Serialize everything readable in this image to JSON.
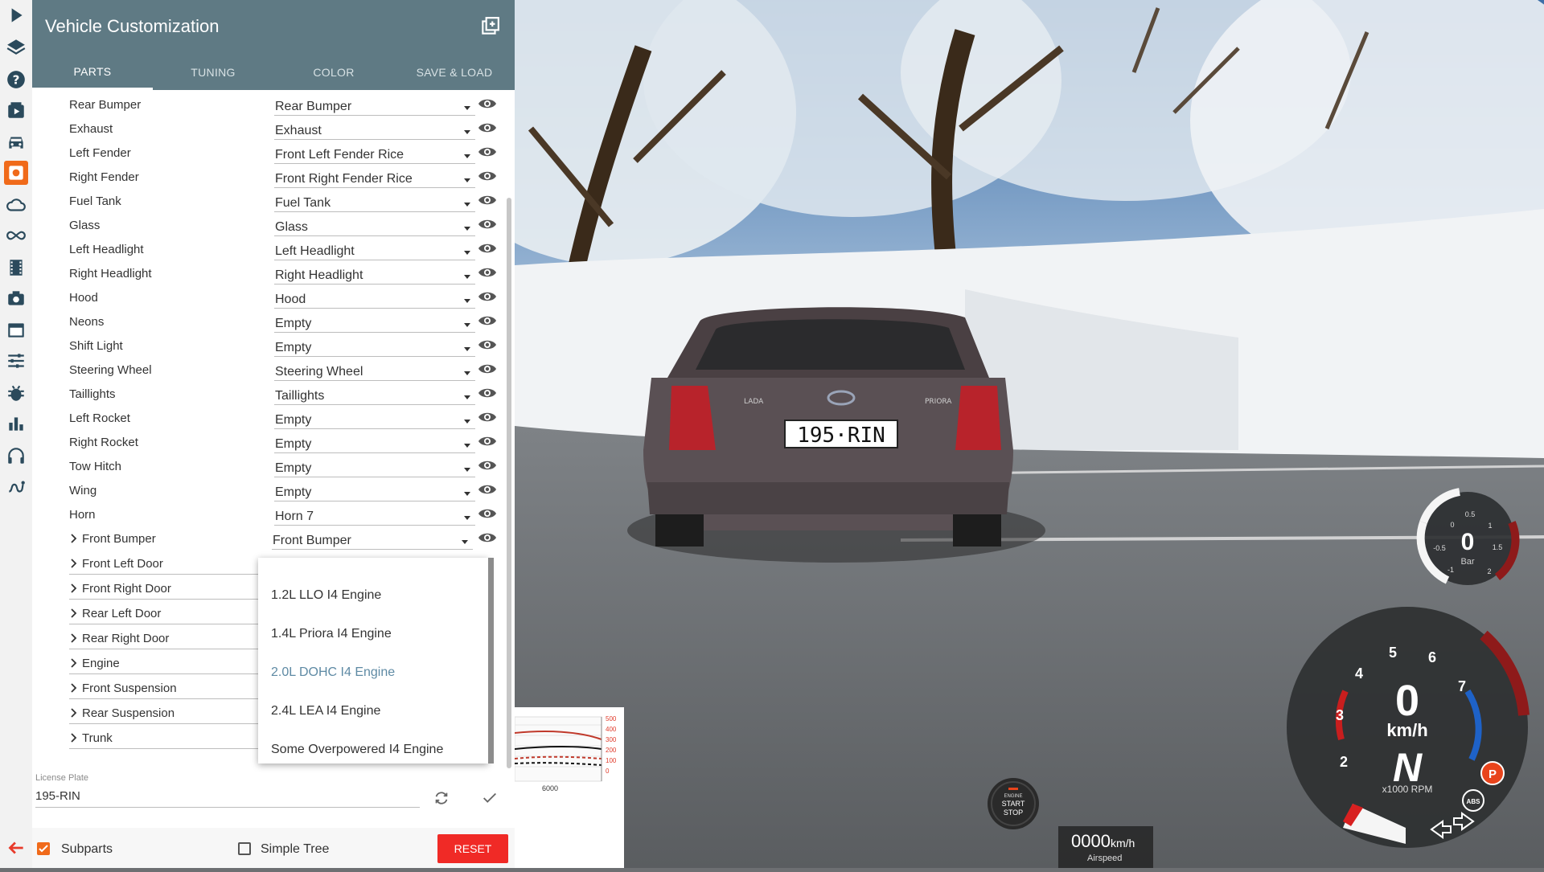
{
  "header": {
    "title": "Vehicle Customization",
    "tabs": [
      {
        "label": "PARTS",
        "active": true
      },
      {
        "label": "TUNING",
        "active": false
      },
      {
        "label": "COLOR",
        "active": false
      },
      {
        "label": "SAVE & LOAD",
        "active": false
      }
    ]
  },
  "rail_icons": [
    "play-icon",
    "layers-icon",
    "help-icon",
    "media-icon",
    "car-icon",
    "parts-icon",
    "cloud-icon",
    "infinity-icon",
    "film-icon",
    "camera-icon",
    "window-icon",
    "sliders-icon",
    "bug-icon",
    "chart-icon",
    "headphones-icon",
    "route-icon"
  ],
  "parts": [
    {
      "label": "Rear Bumper",
      "value": "Rear Bumper"
    },
    {
      "label": "Exhaust",
      "value": "Exhaust"
    },
    {
      "label": "Left Fender",
      "value": "Front Left Fender Rice"
    },
    {
      "label": "Right Fender",
      "value": "Front Right Fender Rice"
    },
    {
      "label": "Fuel Tank",
      "value": "Fuel Tank"
    },
    {
      "label": "Glass",
      "value": "Glass"
    },
    {
      "label": "Left Headlight",
      "value": "Left Headlight"
    },
    {
      "label": "Right Headlight",
      "value": "Right Headlight"
    },
    {
      "label": "Hood",
      "value": "Hood"
    },
    {
      "label": "Neons",
      "value": "Empty"
    },
    {
      "label": "Shift Light",
      "value": "Empty"
    },
    {
      "label": "Steering Wheel",
      "value": "Steering Wheel"
    },
    {
      "label": "Taillights",
      "value": "Taillights"
    },
    {
      "label": "Left Rocket",
      "value": "Empty"
    },
    {
      "label": "Right Rocket",
      "value": "Empty"
    },
    {
      "label": "Tow Hitch",
      "value": "Empty"
    },
    {
      "label": "Wing",
      "value": "Empty"
    },
    {
      "label": "Horn",
      "value": "Horn 7"
    }
  ],
  "groups": [
    {
      "label": "Front Bumper",
      "value": "Front Bumper"
    },
    {
      "label": "Front Left Door"
    },
    {
      "label": "Front Right Door"
    },
    {
      "label": "Rear Left Door"
    },
    {
      "label": "Rear Right Door"
    },
    {
      "label": "Engine"
    },
    {
      "label": "Front Suspension"
    },
    {
      "label": "Rear Suspension"
    },
    {
      "label": "Trunk"
    }
  ],
  "dropdown": {
    "options": [
      "1.2L LLO I4 Engine",
      "1.4L Priora I4 Engine",
      "2.0L DOHC I4 Engine",
      "2.4L LEA I4 Engine",
      "Some Overpowered I4 Engine"
    ],
    "selected": "2.0L DOHC I4 Engine"
  },
  "license": {
    "label": "License Plate",
    "value": "195-RIN"
  },
  "bottom": {
    "subparts_label": "Subparts",
    "subparts_checked": true,
    "simple_tree_label": "Simple Tree",
    "simple_tree_checked": false,
    "reset_label": "RESET"
  },
  "plate_text": "195·RIN",
  "car_badges": {
    "left": "LADA",
    "right": "PRIORA"
  },
  "mini_graph": {
    "y_ticks": [
      "500",
      "400",
      "300",
      "200",
      "100",
      "0"
    ],
    "x_label": "6000"
  },
  "boost_gauge": {
    "value": "0",
    "unit": "Bar",
    "ticks": [
      "0.5",
      "1",
      "1.5",
      "2",
      "0",
      "-0.5",
      "-1"
    ]
  },
  "speedometer": {
    "speed": "0",
    "unit": "km/h",
    "gear": "N",
    "rpm_label": "x1000 RPM",
    "numbers": [
      "2",
      "3",
      "4",
      "5",
      "6",
      "7"
    ],
    "parking": "P",
    "abs": "ABS"
  },
  "engine_button": {
    "line1": "ENGINE",
    "line2": "START",
    "line3": "STOP"
  },
  "airspeed": {
    "value": "0000",
    "unit": "km/h",
    "label": "Airspeed"
  },
  "colors": {
    "header": "#5f7a84",
    "accent": "#f06a1a",
    "reset": "#f02a26",
    "selected_option": "#5e8aa4"
  }
}
